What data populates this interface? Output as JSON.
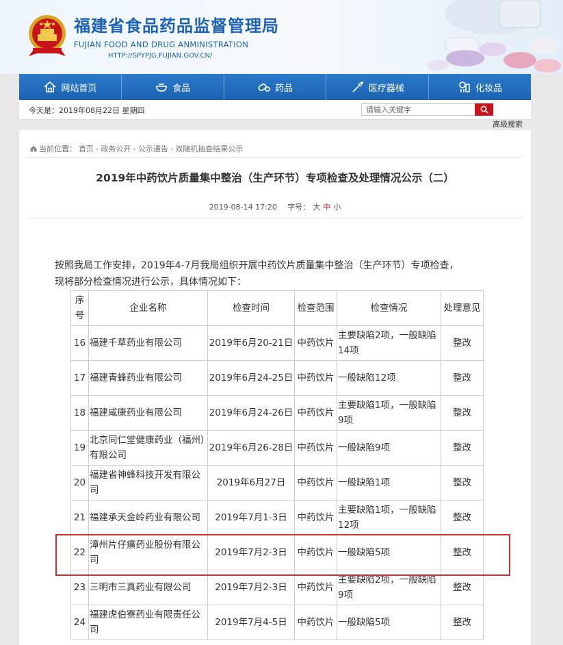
{
  "header": {
    "title": "福建省食品药品监督管理局",
    "title_en": "FUJIAN FOOD AND DRUG ANMINISTRATION",
    "url": "HTTP://SPYPJG.FUJIAN.GOV.CN/"
  },
  "nav": [
    {
      "label": "网站首页",
      "icon": "home-icon"
    },
    {
      "label": "食品",
      "icon": "bowl-icon"
    },
    {
      "label": "药品",
      "icon": "pill-icon"
    },
    {
      "label": "医疗器械",
      "icon": "syringe-icon"
    },
    {
      "label": "化妆品",
      "icon": "cosmetics-icon"
    }
  ],
  "infobar": {
    "today": "今天是：2019年08月22日 星期四",
    "search_placeholder": "请输入关键字",
    "advanced_search": "高级搜索"
  },
  "breadcrumb": {
    "prefix": "当前位置：",
    "items": [
      "首页",
      "政务公开",
      "公示通告",
      "双随机抽查结果公示"
    ]
  },
  "article": {
    "title": "2019年中药饮片质量集中整治（生产环节）专项检查及处理情况公示（二）",
    "date": "2019-08-14 17:20",
    "font_size_label": "字号：",
    "font_sizes": [
      "大",
      "中",
      "小"
    ],
    "font_size_active": "中",
    "intro_line1": "按照我局工作安排，2019年4-7月我局组织开展中药饮片质量集中整治（生产环节）专项检查，",
    "intro_line2": "现将部分检查情况进行公示，具体情况如下："
  },
  "table": {
    "headers": [
      "序号",
      "企业名称",
      "检查时间",
      "检查范围",
      "检查情况",
      "处理意见"
    ],
    "rows": [
      [
        "16",
        "福建千草药业有限公司",
        "2019年6月20-21日",
        "中药饮片",
        "主要缺陷2项，一般缺陷14项",
        "整改"
      ],
      [
        "17",
        "福建青蜂药业有限公司",
        "2019年6月24-25日",
        "中药饮片",
        "一般缺陷12项",
        "整改"
      ],
      [
        "18",
        "福建咸康药业有限公司",
        "2019年6月24-26日",
        "中药饮片",
        "主要缺陷1项，一般缺陷9项",
        "整改"
      ],
      [
        "19",
        "北京同仁堂健康药业（福州）有限公司",
        "2019年6月26-28日",
        "中药饮片",
        "一般缺陷9项",
        "整改"
      ],
      [
        "20",
        "福建省神蜂科技开发有限公司",
        "2019年6月27日",
        "中药饮片",
        "一般缺陷1项",
        "整改"
      ],
      [
        "21",
        "福建承天金岭药业有限公司",
        "2019年7月1-3日",
        "中药饮片",
        "主要缺陷1项，一般缺陷12项",
        "整改"
      ],
      [
        "22",
        "漳州片仔癀药业股份有限公司",
        "2019年7月2-3日",
        "中药饮片",
        "一般缺陷5项",
        "整改"
      ],
      [
        "23",
        "三明市三真药业有限公司",
        "2019年7月2-3日",
        "中药饮片",
        "主要缺陷2项，一般缺陷9项",
        "整改"
      ],
      [
        "24",
        "福建虎伯寮药业有限责任公司",
        "2019年7月4-5日",
        "中药饮片",
        "一般缺陷5项",
        "整改"
      ]
    ]
  },
  "colors": {
    "brand_blue": "#1d62b4",
    "accent_red": "#c8141a",
    "highlight_red": "#d42b2b"
  }
}
